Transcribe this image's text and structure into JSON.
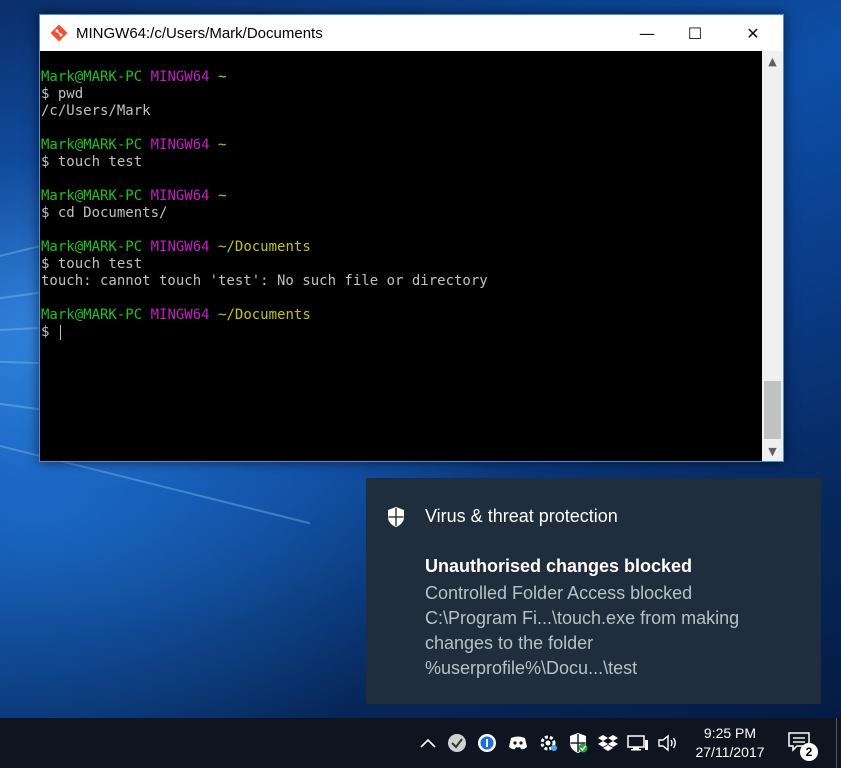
{
  "window": {
    "title": "MINGW64:/c/Users/Mark/Documents",
    "minimize_label": "—",
    "maximize_label": "☐",
    "close_label": "✕"
  },
  "terminal": {
    "lines": [
      {
        "segments": [
          {
            "text": "Mark@MARK-PC",
            "color": "green"
          },
          {
            "text": " ",
            "color": "default"
          },
          {
            "text": "MINGW64",
            "color": "magenta"
          },
          {
            "text": " ~",
            "color": "yellow"
          }
        ]
      },
      {
        "segments": [
          {
            "text": "$ pwd",
            "color": "default"
          }
        ]
      },
      {
        "segments": [
          {
            "text": "/c/Users/Mark",
            "color": "default"
          }
        ]
      },
      {
        "segments": []
      },
      {
        "segments": [
          {
            "text": "Mark@MARK-PC",
            "color": "green"
          },
          {
            "text": " ",
            "color": "default"
          },
          {
            "text": "MINGW64",
            "color": "magenta"
          },
          {
            "text": " ~",
            "color": "yellow"
          }
        ]
      },
      {
        "segments": [
          {
            "text": "$ touch test",
            "color": "default"
          }
        ]
      },
      {
        "segments": []
      },
      {
        "segments": [
          {
            "text": "Mark@MARK-PC",
            "color": "green"
          },
          {
            "text": " ",
            "color": "default"
          },
          {
            "text": "MINGW64",
            "color": "magenta"
          },
          {
            "text": " ~",
            "color": "yellow"
          }
        ]
      },
      {
        "segments": [
          {
            "text": "$ cd Documents/",
            "color": "default"
          }
        ]
      },
      {
        "segments": []
      },
      {
        "segments": [
          {
            "text": "Mark@MARK-PC",
            "color": "green"
          },
          {
            "text": " ",
            "color": "default"
          },
          {
            "text": "MINGW64",
            "color": "magenta"
          },
          {
            "text": " ~/Documents",
            "color": "yellow"
          }
        ]
      },
      {
        "segments": [
          {
            "text": "$ touch test",
            "color": "default"
          }
        ]
      },
      {
        "segments": [
          {
            "text": "touch: cannot touch 'test': No such file or directory",
            "color": "default"
          }
        ]
      },
      {
        "segments": []
      },
      {
        "segments": [
          {
            "text": "Mark@MARK-PC",
            "color": "green"
          },
          {
            "text": " ",
            "color": "default"
          },
          {
            "text": "MINGW64",
            "color": "magenta"
          },
          {
            "text": " ~/Documents",
            "color": "yellow"
          }
        ]
      },
      {
        "segments": [
          {
            "text": "$ ",
            "color": "default"
          }
        ],
        "cursor": true
      }
    ]
  },
  "toast": {
    "app_name": "Virus & threat protection",
    "title": "Unauthorised changes blocked",
    "body": "Controlled Folder Access blocked C:\\Program Fi...\\touch.exe from making changes to the folder %userprofile%\\Docu...\\test"
  },
  "taskbar": {
    "time": "9:25 PM",
    "date": "27/11/2017",
    "notification_count": "2",
    "tray_icons": [
      "chevron-up-icon",
      "checkmark-circle-icon",
      "info-circle-icon",
      "discord-icon",
      "settings-gear-icon",
      "defender-shield-icon",
      "dropbox-icon",
      "network-icon",
      "volume-icon"
    ]
  },
  "colors": {
    "prompt_user": "#1fc21f",
    "prompt_host": "#c31fc3",
    "prompt_path": "#c1c11f",
    "terminal_text": "#c0c0c0",
    "toast_bg": "#1f2d3d"
  }
}
